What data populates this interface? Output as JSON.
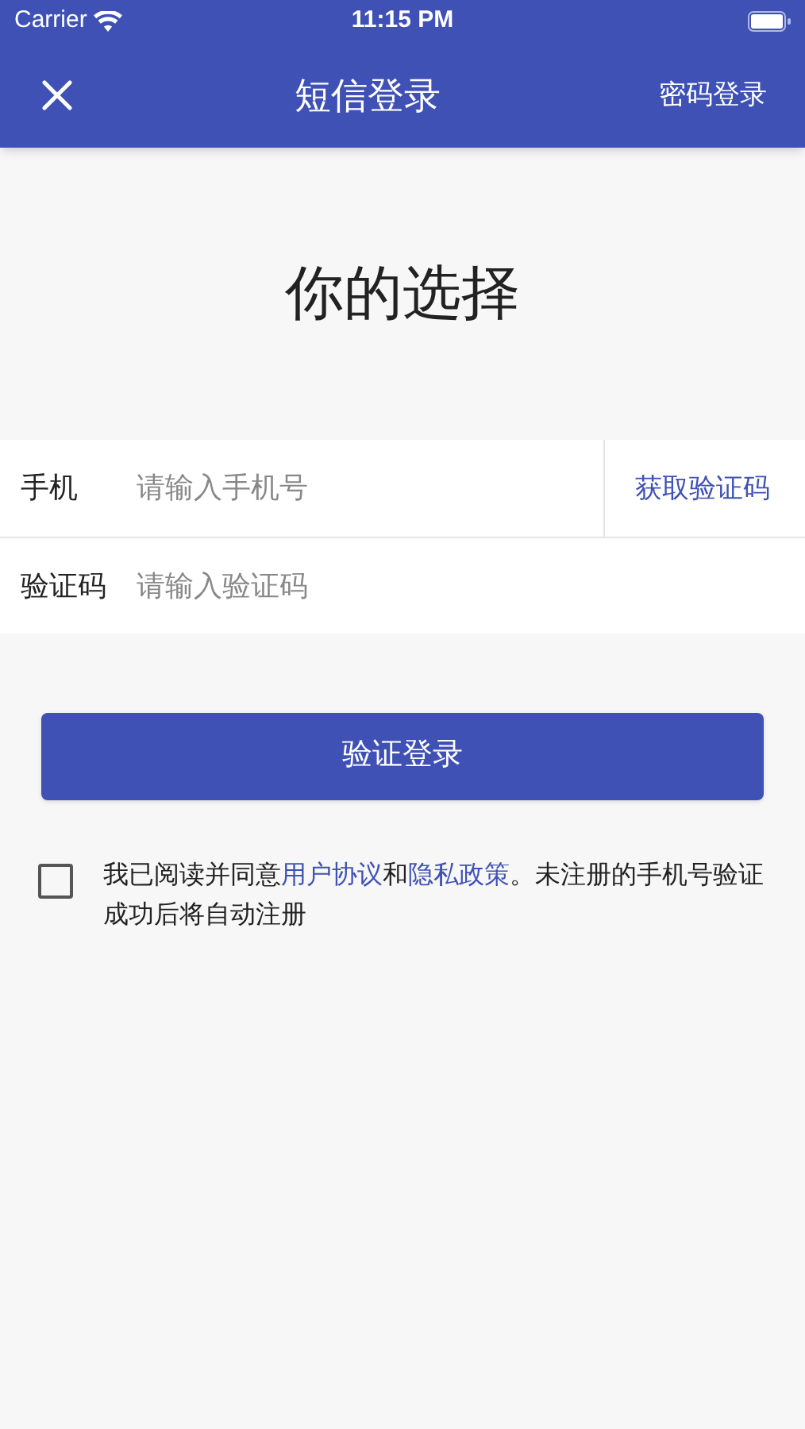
{
  "status_bar": {
    "carrier": "Carrier",
    "time": "11:15 PM"
  },
  "nav": {
    "title": "短信登录",
    "action": "密码登录"
  },
  "heading": "你的选择",
  "form": {
    "rows": [
      {
        "label": "手机",
        "placeholder": "请输入手机号",
        "action": "获取验证码"
      },
      {
        "label": "验证码",
        "placeholder": "请输入验证码"
      }
    ]
  },
  "submit": "验证登录",
  "agreement": {
    "checked": false,
    "parts": [
      {
        "kind": "text",
        "text": "我已阅读并同意"
      },
      {
        "kind": "link",
        "text": "用户协议"
      },
      {
        "kind": "text",
        "text": "和"
      },
      {
        "kind": "link",
        "text": "隐私政策"
      },
      {
        "kind": "text",
        "text": "。未注册的手机号验证成功后将自动注册"
      }
    ]
  }
}
